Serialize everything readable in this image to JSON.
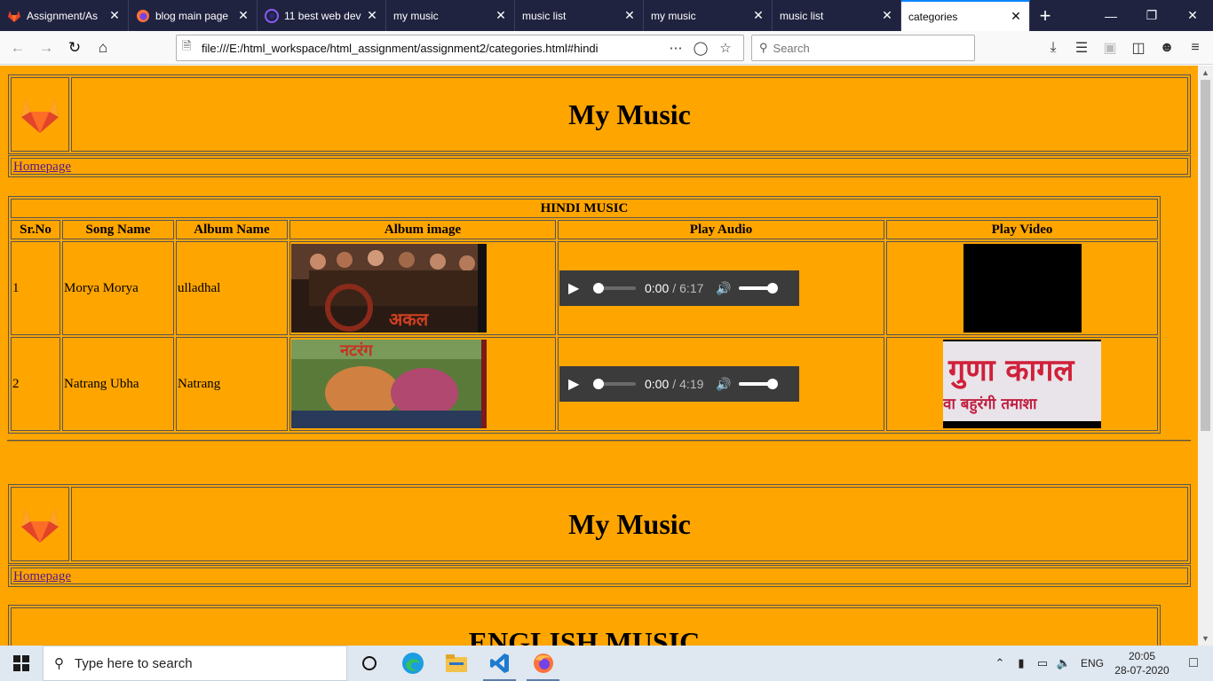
{
  "browser": {
    "tabs": [
      {
        "title": "Assignment/As",
        "icon": "gitlab-icon",
        "active": false
      },
      {
        "title": "blog main page",
        "icon": "firefox-icon",
        "active": false
      },
      {
        "title": "11 best web dev",
        "icon": "tor-icon",
        "active": false
      },
      {
        "title": "my music",
        "icon": "",
        "active": false
      },
      {
        "title": "music list",
        "icon": "",
        "active": false
      },
      {
        "title": "my music",
        "icon": "",
        "active": false
      },
      {
        "title": "music list",
        "icon": "",
        "active": false
      },
      {
        "title": "categories",
        "icon": "",
        "active": true
      }
    ],
    "url": "file:///E:/html_workspace/html_assignment/assignment2/categories.html#hindi",
    "search_placeholder": "Search"
  },
  "page": {
    "site_title": "My Music",
    "nav_link": "Homepage",
    "hindi_caption": "HINDI MUSIC",
    "columns": [
      "Sr.No",
      "Song Name",
      "Album Name",
      "Album image",
      "Play Audio",
      "Play Video"
    ],
    "rows": [
      {
        "sr": "1",
        "song": "Morya Morya",
        "album": "ulladhal",
        "audio_current": "0:00",
        "audio_duration": "6:17"
      },
      {
        "sr": "2",
        "song": "Natrang Ubha",
        "album": "Natrang",
        "audio_current": "0:00",
        "audio_duration": "4:19"
      }
    ],
    "video_text_line1": "गुणा कागल",
    "video_text_line2": "वा बहुरंगी तमाशा",
    "english_caption": "ENGLISH MUSIC"
  },
  "taskbar": {
    "search_placeholder": "Type here to search",
    "language": "ENG",
    "time": "20:05",
    "date": "28-07-2020"
  },
  "colors": {
    "page_background": "#ffa500",
    "tab_strip": "#202340",
    "link": "#551a8b"
  }
}
